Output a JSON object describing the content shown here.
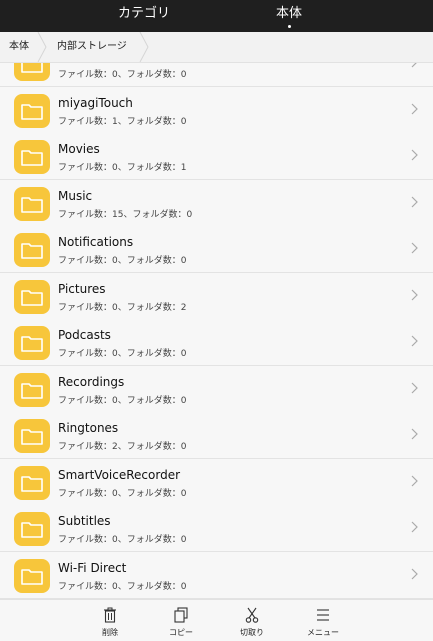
{
  "tabs": [
    {
      "label": "カテゴリ",
      "active": false
    },
    {
      "label": "本体",
      "active": true
    }
  ],
  "breadcrumb": [
    {
      "label": "本体"
    },
    {
      "label": "内部ストレージ"
    }
  ],
  "folders": [
    {
      "name": "",
      "meta": "ファイル数：0、フォルダ数：0"
    },
    {
      "name": "miyagiTouch",
      "meta": "ファイル数：1、フォルダ数：0"
    },
    {
      "name": "Movies",
      "meta": "ファイル数：0、フォルダ数：1"
    },
    {
      "name": "Music",
      "meta": "ファイル数：15、フォルダ数：0"
    },
    {
      "name": "Notifications",
      "meta": "ファイル数：0、フォルダ数：0"
    },
    {
      "name": "Pictures",
      "meta": "ファイル数：0、フォルダ数：2"
    },
    {
      "name": "Podcasts",
      "meta": "ファイル数：0、フォルダ数：0"
    },
    {
      "name": "Recordings",
      "meta": "ファイル数：0、フォルダ数：0"
    },
    {
      "name": "Ringtones",
      "meta": "ファイル数：2、フォルダ数：0"
    },
    {
      "name": "SmartVoiceRecorder",
      "meta": "ファイル数：0、フォルダ数：0"
    },
    {
      "name": "Subtitles",
      "meta": "ファイル数：0、フォルダ数：0"
    },
    {
      "name": "Wi-Fi Direct",
      "meta": "ファイル数：0、フォルダ数：0"
    }
  ],
  "actions": [
    {
      "label": "削除",
      "icon": "trash-icon"
    },
    {
      "label": "コピー",
      "icon": "copy-icon"
    },
    {
      "label": "切取り",
      "icon": "scissors-icon"
    },
    {
      "label": "メニュー",
      "icon": "menu-icon"
    }
  ],
  "colors": {
    "folder": "#f7c63b",
    "topbar": "#1f1f1f"
  }
}
